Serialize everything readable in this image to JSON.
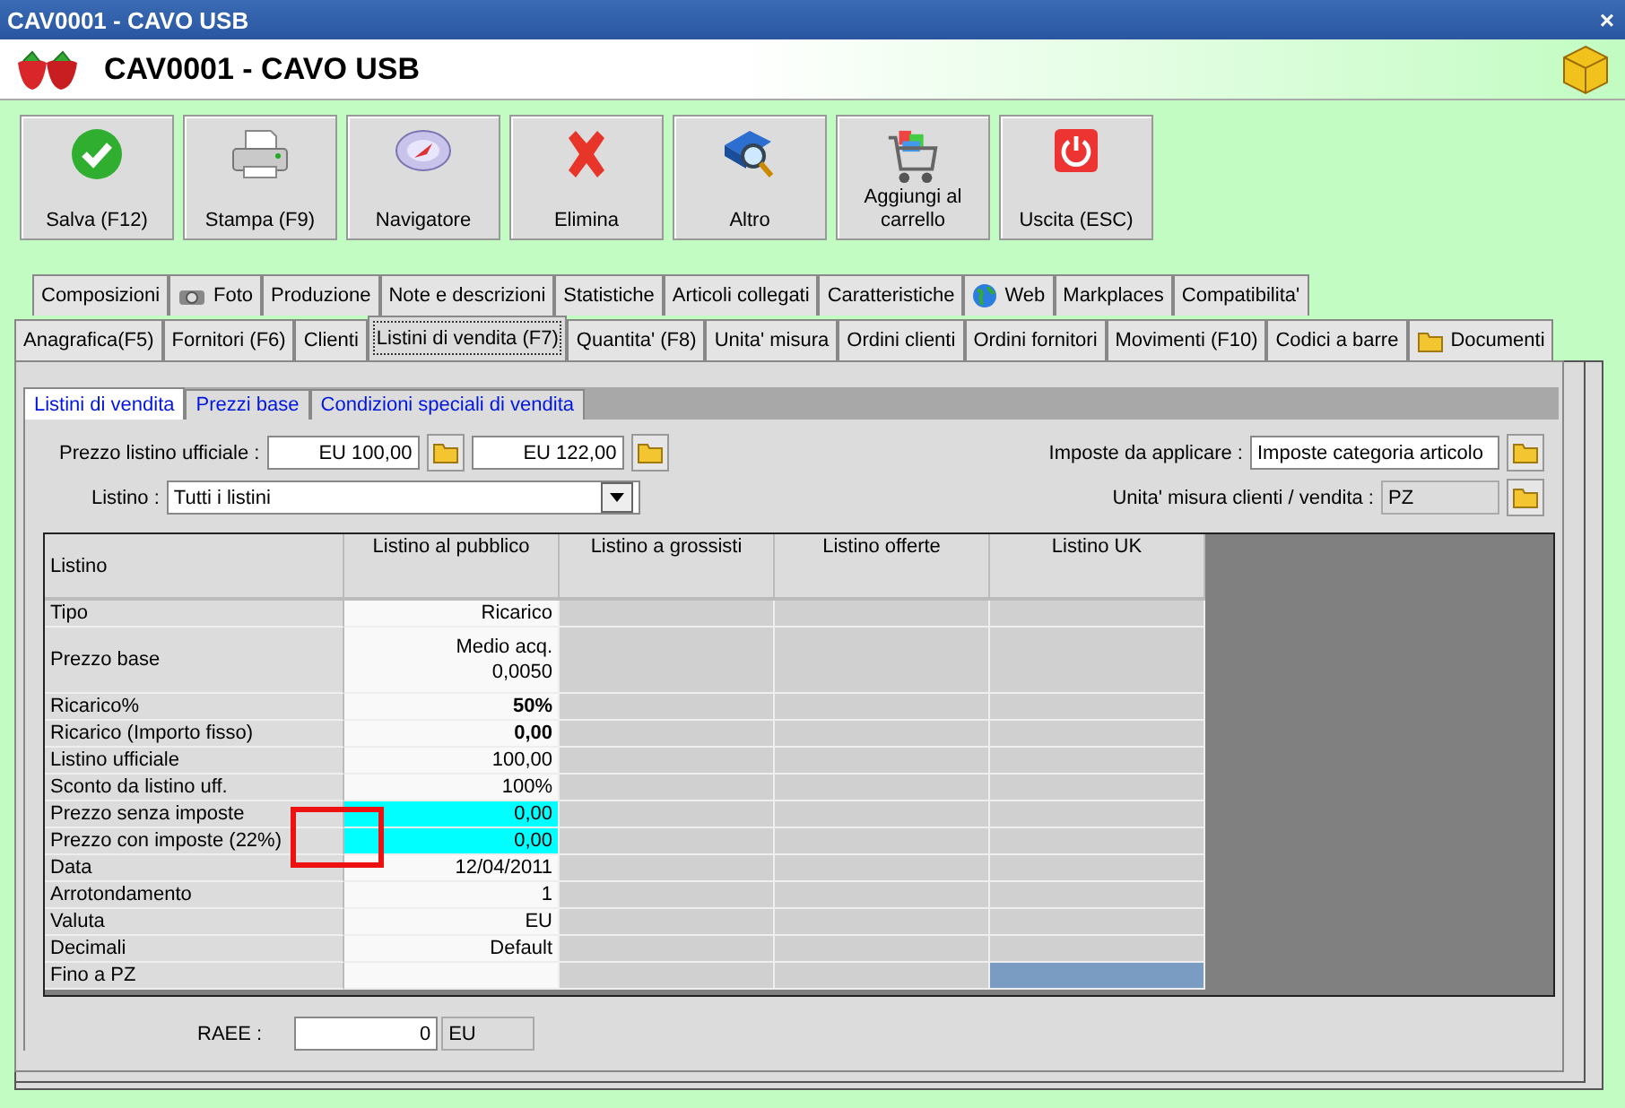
{
  "window": {
    "title": "CAV0001 - CAVO USB",
    "close": "×"
  },
  "header": {
    "title": "CAV0001 - CAVO USB"
  },
  "toolbar": [
    {
      "label": "Salva (F12)",
      "kind": "check"
    },
    {
      "label": "Stampa (F9)",
      "kind": "printer"
    },
    {
      "label": "Navigatore",
      "kind": "compass"
    },
    {
      "label": "Elimina",
      "kind": "cross"
    },
    {
      "label": "Altro",
      "kind": "search"
    },
    {
      "label": "Aggiungi al carrello",
      "kind": "cart"
    },
    {
      "label": "Uscita (ESC)",
      "kind": "power"
    }
  ],
  "tabs_back": [
    {
      "label": "Composizioni",
      "kind": "plain",
      "selected": false
    },
    {
      "label": "Foto",
      "kind": "camera",
      "selected": false
    },
    {
      "label": "Produzione",
      "kind": "plain",
      "selected": false
    },
    {
      "label": "Note e descrizioni",
      "kind": "plain",
      "selected": false
    },
    {
      "label": "Statistiche",
      "kind": "plain",
      "selected": false
    },
    {
      "label": "Articoli collegati",
      "kind": "plain",
      "selected": false
    },
    {
      "label": "Caratteristiche",
      "kind": "plain",
      "selected": false
    },
    {
      "label": "Web",
      "kind": "globe",
      "selected": false
    },
    {
      "label": "Markplaces",
      "kind": "plain",
      "selected": false
    },
    {
      "label": "Compatibilita'",
      "kind": "plain",
      "selected": false
    }
  ],
  "tabs_front": [
    {
      "label": "Anagrafica(F5)",
      "kind": "plain",
      "selected": false
    },
    {
      "label": "Fornitori (F6)",
      "kind": "plain",
      "selected": false
    },
    {
      "label": "Clienti",
      "kind": "plain",
      "selected": false
    },
    {
      "label": "Listini di vendita (F7)",
      "kind": "plain",
      "selected": true
    },
    {
      "label": "Quantita' (F8)",
      "kind": "plain",
      "selected": false
    },
    {
      "label": "Unita' misura",
      "kind": "plain",
      "selected": false
    },
    {
      "label": "Ordini clienti",
      "kind": "plain",
      "selected": false
    },
    {
      "label": "Ordini fornitori",
      "kind": "plain",
      "selected": false
    },
    {
      "label": "Movimenti (F10)",
      "kind": "plain",
      "selected": false
    },
    {
      "label": "Codici a barre",
      "kind": "plain",
      "selected": false
    },
    {
      "label": "Documenti",
      "kind": "folder",
      "selected": false
    }
  ],
  "sub_tabs": [
    {
      "label": "Listini di vendita",
      "selected": true
    },
    {
      "label": "Prezzi base",
      "selected": false
    },
    {
      "label": "Condizioni speciali di vendita",
      "selected": false
    }
  ],
  "form": {
    "prezzo_listino_label": "Prezzo listino ufficiale :",
    "prezzo_listino_values": [
      "EU 100,00",
      "EU 122,00"
    ],
    "listino_label": "Listino :",
    "listino_value": "Tutti i listini",
    "imposte_label": "Imposte da applicare :",
    "imposte_value": "Imposte categoria articolo",
    "unita_label": "Unita' misura clienti / vendita :",
    "unita_value": "PZ"
  },
  "grid": {
    "corner": "Listino",
    "columns": [
      {
        "label": "Listino al pubblico"
      },
      {
        "label": "Listino a grossisti"
      },
      {
        "label": "Listino offerte"
      },
      {
        "label": "Listino UK"
      }
    ],
    "rows": [
      {
        "label": "Tipo",
        "value": "Ricarico",
        "bold": false,
        "highlighted": false,
        "tall": false,
        "selected": false
      },
      {
        "label": "Prezzo base",
        "value": "Medio acq.\n0,0050",
        "bold": false,
        "highlighted": false,
        "tall": true,
        "selected": false
      },
      {
        "label": "Ricarico%",
        "value": "50%",
        "bold": true,
        "highlighted": false,
        "tall": false,
        "selected": false
      },
      {
        "label": "Ricarico (Importo fisso)",
        "value": "0,00",
        "bold": true,
        "highlighted": false,
        "tall": false,
        "selected": false
      },
      {
        "label": "Listino ufficiale",
        "value": "100,00",
        "bold": false,
        "highlighted": false,
        "tall": false,
        "selected": false
      },
      {
        "label": "Sconto da listino uff.",
        "value": "100%",
        "bold": false,
        "highlighted": false,
        "tall": false,
        "selected": false
      },
      {
        "label": "Prezzo senza imposte",
        "value": "0,00",
        "bold": false,
        "highlighted": true,
        "tall": false,
        "selected": false
      },
      {
        "label": "Prezzo con imposte (22%)",
        "value": "0,00",
        "bold": false,
        "highlighted": true,
        "tall": false,
        "selected": false
      },
      {
        "label": "Data",
        "value": "12/04/2011",
        "bold": false,
        "highlighted": false,
        "tall": false,
        "selected": false
      },
      {
        "label": "Arrotondamento",
        "value": "1",
        "bold": false,
        "highlighted": false,
        "tall": false,
        "selected": false
      },
      {
        "label": "Valuta",
        "value": "EU",
        "bold": false,
        "highlighted": false,
        "tall": false,
        "selected": false
      },
      {
        "label": "Decimali",
        "value": "Default",
        "bold": false,
        "highlighted": false,
        "tall": false,
        "selected": false
      },
      {
        "label": "Fino a PZ",
        "value": "",
        "bold": false,
        "highlighted": false,
        "tall": false,
        "selected": true
      }
    ]
  },
  "raee": {
    "label": "RAEE :",
    "value": "0",
    "unit": "EU"
  }
}
